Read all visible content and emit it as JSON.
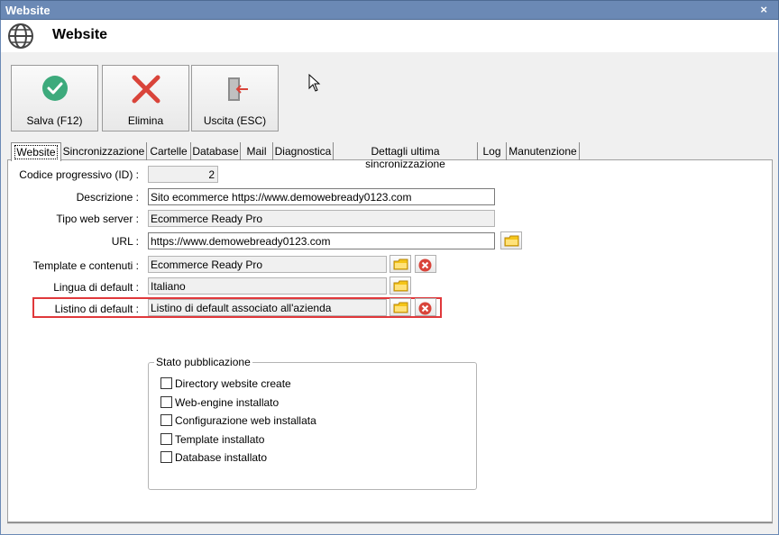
{
  "window": {
    "title": "Website",
    "close_glyph": "×"
  },
  "header": {
    "title": "Website",
    "icon": "globe-icon"
  },
  "toolbar": {
    "save_label": "Salva (F12)",
    "delete_label": "Elimina",
    "exit_label": "Uscita (ESC)"
  },
  "tabs": [
    {
      "label": "Website"
    },
    {
      "label": "Sincronizzazione"
    },
    {
      "label": "Cartelle"
    },
    {
      "label": "Database"
    },
    {
      "label": "Mail"
    },
    {
      "label": "Diagnostica"
    },
    {
      "label": "Dettagli ultima sincronizzazione"
    },
    {
      "label": "Log"
    },
    {
      "label": "Manutenzione"
    }
  ],
  "form": {
    "id_label": "Codice progressivo (ID) :",
    "id_value": "2",
    "desc_label": "Descrizione :",
    "desc_value": "Sito ecommerce https://www.demowebready0123.com",
    "server_label": "Tipo web server :",
    "server_value": "Ecommerce Ready Pro",
    "url_label": "URL :",
    "url_value": "https://www.demowebready0123.com",
    "template_label": "Template e contenuti :",
    "template_value": "Ecommerce Ready Pro",
    "lang_label": "Lingua di default :",
    "lang_value": "Italiano",
    "list_label": "Listino di default :",
    "list_value": "Listino di default associato all'azienda"
  },
  "status": {
    "title": "Stato pubblicazione",
    "items": [
      {
        "label": "Directory website create",
        "checked": false
      },
      {
        "label": "Web-engine installato",
        "checked": false
      },
      {
        "label": "Configurazione web installata",
        "checked": false
      },
      {
        "label": "Template installato",
        "checked": false
      },
      {
        "label": "Database installato",
        "checked": false
      }
    ]
  },
  "colors": {
    "titlebar": "#6b89b5",
    "save_check": "#3daa7c",
    "delete_x": "#d9443a",
    "highlight": "#e0383b"
  }
}
